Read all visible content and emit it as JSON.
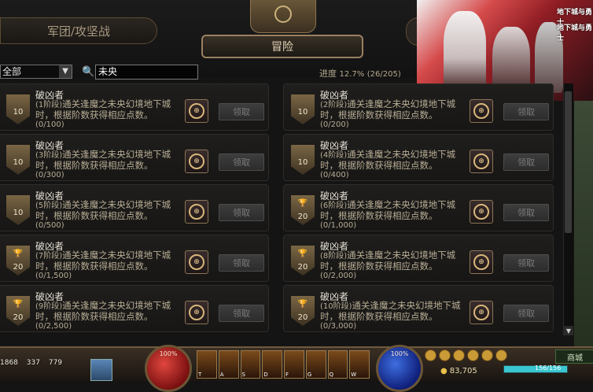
{
  "tabs": {
    "legion": "军团/攻坚战",
    "adventure": "冒险"
  },
  "filter": {
    "category": "全部",
    "search_value": "未央"
  },
  "progress": {
    "label": "进度",
    "percent": "12.7%",
    "count": "(26/205)"
  },
  "claim_label": "领取",
  "achievements": [
    {
      "title": "破凶者",
      "stage": "(1阶段)",
      "desc": "通关逢魔之未央幻境地下城时，根据阶数获得相应点数。",
      "progress": "(0/100)",
      "points": "10",
      "trophy": false
    },
    {
      "title": "破凶者",
      "stage": "(2阶段)",
      "desc": "通关逢魔之未央幻境地下城时，根据阶数获得相应点数。",
      "progress": "(0/200)",
      "points": "10",
      "trophy": false
    },
    {
      "title": "破凶者",
      "stage": "(3阶段)",
      "desc": "通关逢魔之未央幻境地下城时，根据阶数获得相应点数。",
      "progress": "(0/300)",
      "points": "10",
      "trophy": false
    },
    {
      "title": "破凶者",
      "stage": "(4阶段)",
      "desc": "通关逢魔之未央幻境地下城时，根据阶数获得相应点数。",
      "progress": "(0/400)",
      "points": "10",
      "trophy": false
    },
    {
      "title": "破凶者",
      "stage": "(5阶段)",
      "desc": "通关逢魔之未央幻境地下城时，根据阶数获得相应点数。",
      "progress": "(0/500)",
      "points": "10",
      "trophy": false
    },
    {
      "title": "破凶者",
      "stage": "(6阶段)",
      "desc": "通关逢魔之未央幻境地下城时，根据阶数获得相应点数。",
      "progress": "(0/1,000)",
      "points": "20",
      "trophy": true
    },
    {
      "title": "破凶者",
      "stage": "(7阶段)",
      "desc": "通关逢魔之未央幻境地下城时，根据阶数获得相应点数。",
      "progress": "(0/1,500)",
      "points": "20",
      "trophy": true
    },
    {
      "title": "破凶者",
      "stage": "(8阶段)",
      "desc": "通关逢魔之未央幻境地下城时，根据阶数获得相应点数。",
      "progress": "(0/2,000)",
      "points": "20",
      "trophy": true
    },
    {
      "title": "破凶者",
      "stage": "(9阶段)",
      "desc": "通关逢魔之未央幻境地下城时，根据阶数获得相应点数。",
      "progress": "(0/2,500)",
      "points": "20",
      "trophy": true
    },
    {
      "title": "破凶者",
      "stage": "(10阶段)",
      "desc": "通关逢魔之未央幻境地下城时，根据阶数获得相应点数。",
      "progress": "(0/3,000)",
      "points": "20",
      "trophy": true
    }
  ],
  "hud": {
    "stat1": "1868",
    "stat2": "337",
    "stat3": "779",
    "hp_orb": "100%",
    "mp_orb": "100%",
    "gold": "83,705",
    "shop": "商城",
    "hp_text": "156/156",
    "hp_fraction": 1.0,
    "skill_keys": [
      "T",
      "A",
      "S",
      "D",
      "F",
      "G",
      "Q",
      "W"
    ]
  },
  "ad": {
    "logo_top": "地下城与勇士",
    "logo_bottom": "地下城与勇士"
  },
  "colors": {
    "accent_gold": "#9a8060",
    "background": "#141414",
    "text_main": "#e6e1d6"
  }
}
